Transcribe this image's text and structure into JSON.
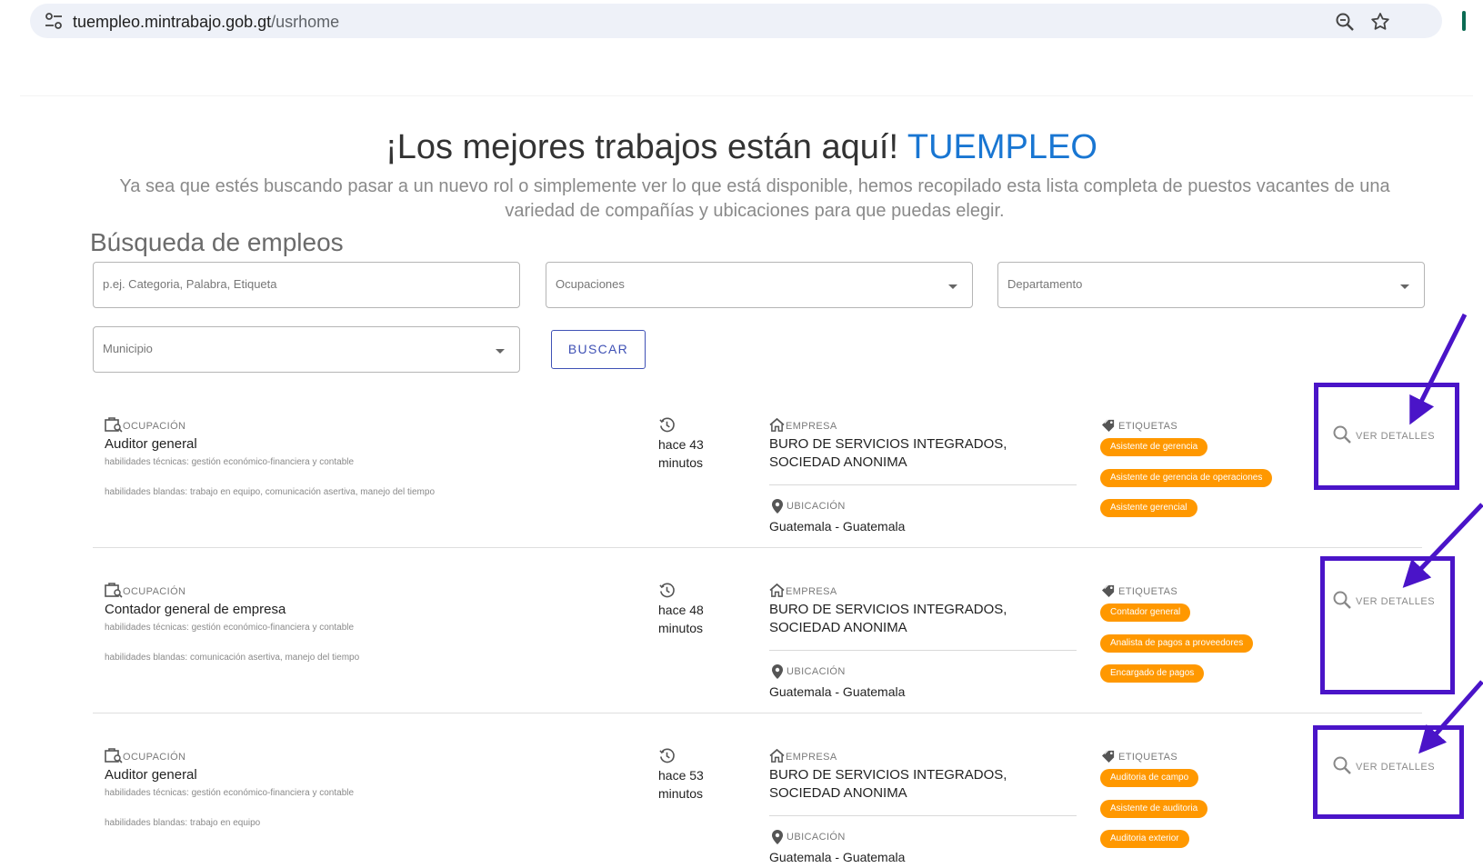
{
  "browser": {
    "url_host": "tuempleo.mintrabajo.gob.gt",
    "url_path": "/usrhome",
    "icons": [
      "tune-icon",
      "zoom-icon",
      "star-icon"
    ]
  },
  "hero": {
    "title": "¡Los mejores trabajos están aquí! ",
    "brand": "TUEMPLEO",
    "subtitle": "Ya sea que estés buscando pasar a un nuevo rol o simplemente ver lo que está disponible, hemos recopilado esta lista completa de puestos vacantes de una variedad de compañías y ubicaciones para que puedas elegir.",
    "brand_color": "#1976d2"
  },
  "search": {
    "title": "Búsqueda de empleos",
    "keyword_placeholder": "p.ej. Categoria, Palabra, Etiqueta",
    "occupations_label": "Ocupaciones",
    "department_label": "Departamento",
    "municipality_label": "Municipio",
    "button_label": "BUSCAR"
  },
  "labels": {
    "occupation": "OCUPACIÓN",
    "company": "EMPRESA",
    "location": "UBICACIÓN",
    "tags": "ETIQUETAS",
    "details": "VER DETALLES"
  },
  "jobs": [
    {
      "occupation": "Auditor general",
      "hard_skills": "habilidades técnicas: gestión económico-financiera y contable",
      "soft_skills": "habilidades blandas: trabajo en equipo, comunicación asertiva, manejo del tiempo",
      "time_line1": "hace 43",
      "time_line2": "minutos",
      "company": "BURO DE SERVICIOS INTEGRADOS, SOCIEDAD ANONIMA",
      "location": "Guatemala - Guatemala",
      "tags": [
        "Asistente de gerencia",
        "Asistente de gerencia de operaciones",
        "Asistente gerencial"
      ]
    },
    {
      "occupation": "Contador general de empresa",
      "hard_skills": "habilidades técnicas: gestión económico-financiera y contable",
      "soft_skills": "habilidades blandas: comunicación asertiva, manejo del tiempo",
      "time_line1": "hace 48",
      "time_line2": "minutos",
      "company": "BURO DE SERVICIOS INTEGRADOS, SOCIEDAD ANONIMA",
      "location": "Guatemala - Guatemala",
      "tags": [
        "Contador general",
        "Analista de pagos a proveedores",
        "Encargado de pagos"
      ]
    },
    {
      "occupation": "Auditor general",
      "hard_skills": "habilidades técnicas: gestión económico-financiera y contable",
      "soft_skills": "habilidades blandas: trabajo en equipo",
      "time_line1": "hace 53",
      "time_line2": "minutos",
      "company": "BURO DE SERVICIOS INTEGRADOS, SOCIEDAD ANONIMA",
      "location": "Guatemala - Guatemala",
      "tags": [
        "Auditoria de campo",
        "Asistente de auditoria",
        "Auditoria exterior"
      ]
    }
  ],
  "colors": {
    "tag_bg": "#ff9800",
    "button_accent": "#3f51b5",
    "annotation": "#4a14c8"
  }
}
